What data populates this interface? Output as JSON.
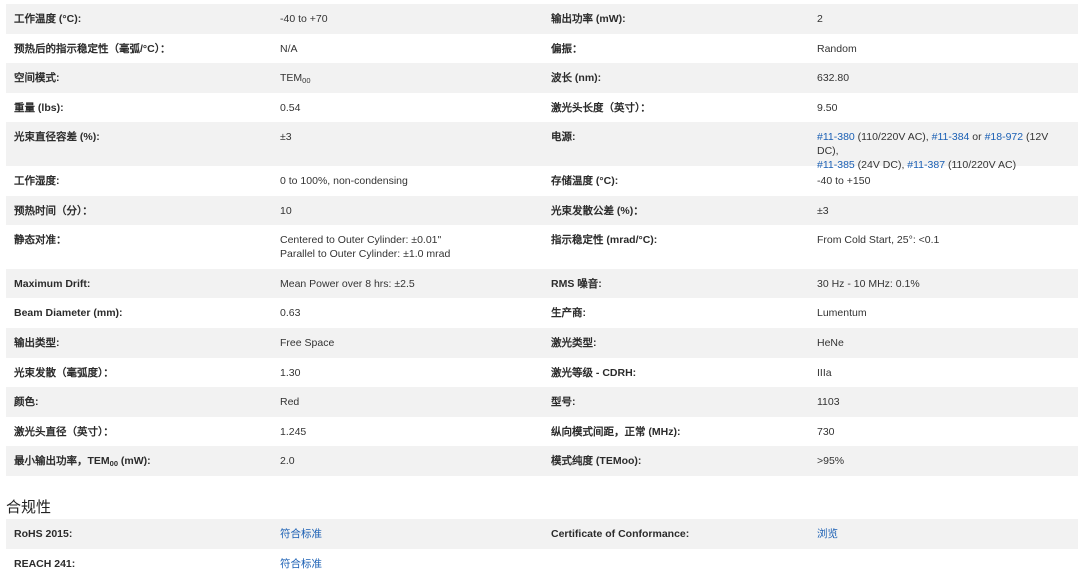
{
  "spec_rows": [
    {
      "l1": "工作温度 (°C):",
      "v1": "-40 to +70",
      "l2": "输出功率 (mW):",
      "v2": "2"
    },
    {
      "l1": "预热后的指示稳定性（毫弧/°C）：",
      "v1": "N/A",
      "l2": "偏振：",
      "v2": "Random"
    },
    {
      "l1": "空间模式:",
      "v1_main": "TEM",
      "v1_sub": "00",
      "l2": "波长 (nm):",
      "v2": "632.80"
    },
    {
      "l1": "重量 (lbs):",
      "v1": "0.54",
      "l2": "激光头长度（英寸）：",
      "v2": "9.50"
    },
    {
      "l1": "光束直径容差 (%):",
      "v1": "±3",
      "l2": "电源:",
      "power_links": [
        {
          "link": "#11-380",
          "text": " (110/220V AC), "
        },
        {
          "link": "#11-384",
          "text": " or "
        },
        {
          "link": "#18-972",
          "text": " (12V DC),"
        },
        {
          "link": "#11-385",
          "text": " (24V DC), "
        },
        {
          "link": "#11-387",
          "text": " (110/220V AC)"
        }
      ]
    },
    {
      "l1": "工作湿度:",
      "v1": "0 to 100%, non-condensing",
      "l2": "存储温度 (°C):",
      "v2": "-40 to +150"
    },
    {
      "l1": "预热时间（分）：",
      "v1": "10",
      "l2": "光束发散公差 (%)：",
      "v2": "±3"
    },
    {
      "l1": "静态对准：",
      "v1_line1": "Centered to Outer Cylinder: ±0.01\"",
      "v1_line2": "Parallel to Outer Cylinder: ±1.0 mrad",
      "l2": "指示稳定性 (mrad/°C):",
      "v2": "From Cold Start, 25°: <0.1"
    },
    {
      "l1": "Maximum Drift:",
      "v1": "Mean Power over 8 hrs: ±2.5",
      "l2": "RMS 噪音:",
      "v2": "30 Hz - 10 MHz: 0.1%"
    },
    {
      "l1": "Beam Diameter (mm):",
      "v1": "0.63",
      "l2": "生产商:",
      "v2": "Lumentum"
    },
    {
      "l1": "输出类型:",
      "v1": "Free Space",
      "l2": "激光类型:",
      "v2": "HeNe"
    },
    {
      "l1": "光束发散（毫弧度）：",
      "v1": "1.30",
      "l2": "激光等级 - CDRH:",
      "v2": "IIIa"
    },
    {
      "l1": "颜色:",
      "v1": "Red",
      "l2": "型号:",
      "v2": "1103"
    },
    {
      "l1": "激光头直径（英寸）：",
      "v1": "1.245",
      "l2": "纵向模式间距，正常 (MHz):",
      "v2": "730"
    },
    {
      "l1_main": "最小输出功率，TEM",
      "l1_sub": "00",
      "l1_tail": " (mW):",
      "v1": "2.0",
      "l2": "模式纯度 (TEMoo):",
      "v2": ">95%"
    }
  ],
  "compliance": {
    "title": "合规性",
    "rows": [
      {
        "l1": "RoHS 2015:",
        "v1": "符合标准",
        "l2": "Certificate of Conformance:",
        "v2": "浏览"
      },
      {
        "l1": "REACH 241:",
        "v1": "符合标准",
        "l2": "",
        "v2": ""
      }
    ]
  },
  "colors": {
    "link": "#1a5fb4",
    "row_stripe": "#f2f2f2"
  }
}
